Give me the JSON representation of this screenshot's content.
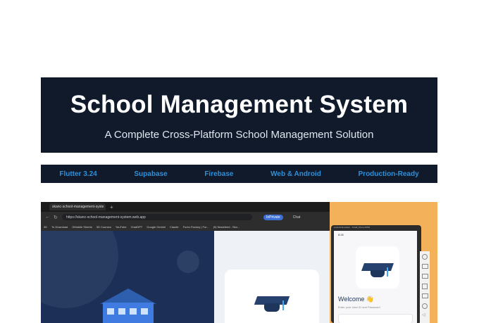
{
  "hero": {
    "title": "School Management System",
    "subtitle": "A Complete Cross-Platform School Management Solution"
  },
  "tags": [
    "Flutter 3.24",
    "Supabase",
    "Firebase",
    "Web & Android",
    "Production-Ready"
  ],
  "browser": {
    "tab_title": "skanc-school-management-syste",
    "url": "https://skanc-school-management-system.web.app",
    "inprivate": "InPrivate",
    "chat": "Chat",
    "bookmarks": [
      "3D",
      "To Download",
      "GMobile Sheets",
      "3D Courses",
      "YouTube",
      "ChatGPT",
      "Google Gemini",
      "Claude",
      "Forex Factory | For...",
      "(5) Newsfeed - Sko..."
    ]
  },
  "phone": {
    "title_bar": "Android Emulator - Small_Phone:5554",
    "time": "8:26",
    "welcome": "Welcome 👋",
    "prompt": "Enter your User ID and Password"
  },
  "colors": {
    "dark_navy": "#101a2b",
    "tag_blue": "#2f8fd8",
    "orange_bg": "#f3b25a"
  }
}
